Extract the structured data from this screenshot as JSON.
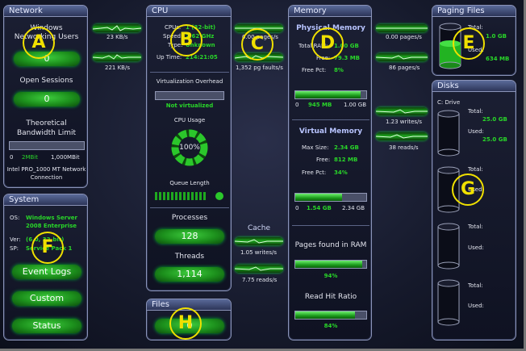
{
  "network": {
    "title": "Network",
    "windows_label": "Windows",
    "networking_users_label": "Networking Users",
    "users_value": "0",
    "open_sessions_label": "Open Sessions",
    "open_sessions_value": "0",
    "bandwidth_label_1": "Theoretical",
    "bandwidth_label_2": "Bandwidth Limit",
    "bw_min": "0",
    "bw_current": "2MBit",
    "bw_max": "1,000MBit",
    "bw_fraction": 0.002,
    "adapter_1": "Intel PRO_1000 MT Network",
    "adapter_2": "Connection",
    "stream_out": "23 KB/s",
    "stream_in": "221 KB/s"
  },
  "system": {
    "title": "System",
    "os_label": "OS:",
    "os_value_1": "Windows Server",
    "os_value_2": "2008 Enterprise",
    "ver_label": "Ver:",
    "ver_value": "(6.0, 32-bit)",
    "sp_label": "SP:",
    "sp_value": "Service Pack 1",
    "event_logs": "Event Logs",
    "custom": "Custom",
    "status": "Status"
  },
  "cpu": {
    "title": "CPU",
    "cpus_label": "CPUs:",
    "cpus_value": "1 (32-bit)",
    "speed_label": "Speed:",
    "speed_value": "2.62 GHz",
    "type_label": "Type:",
    "type_value": "Unknown",
    "uptime_label": "Up Time:",
    "uptime_value": "214:21:05",
    "virt_label": "Virtualization Overhead",
    "virt_status": "Not virtualized",
    "usage_label": "CPU Usage",
    "usage_value": "100%",
    "usage_fraction": 1.0,
    "queue_label": "Queue Length",
    "processes_label": "Processes",
    "processes_value": "128",
    "threads_label": "Threads",
    "threads_value": "1,114",
    "stream_top": "0.00 pages/s",
    "stream_bottom": "1,352 pg faults/s"
  },
  "files": {
    "title": "Files",
    "value": "0"
  },
  "cache": {
    "title": "Cache",
    "writes": "1.05 writes/s",
    "reads": "7.75 reads/s"
  },
  "memory": {
    "title": "Memory",
    "physical_title": "Physical Memory",
    "total_ram_label": "Total RAM:",
    "total_ram_value": "1.00 GB",
    "free_label": "Free:",
    "free_value": "79.3 MB",
    "free_pct_label": "Free Pct:",
    "free_pct_value": "8%",
    "phys_used": "945 MB",
    "phys_min": "0",
    "phys_max": "1.00 GB",
    "phys_fraction": 0.92,
    "virtual_title": "Virtual Memory",
    "max_size_label": "Max Size:",
    "max_size_value": "2.34 GB",
    "vfree_label": "Free:",
    "vfree_value": "812 MB",
    "vfree_pct_label": "Free Pct:",
    "vfree_pct_value": "34%",
    "virt_used": "1.54 GB",
    "virt_min": "0",
    "virt_max": "2.34 GB",
    "virt_fraction": 0.66,
    "pages_ram_label": "Pages found in RAM",
    "pages_ram_value": "94%",
    "pages_ram_fraction": 0.94,
    "read_hit_label": "Read Hit Ratio",
    "read_hit_value": "84%",
    "read_hit_fraction": 0.84
  },
  "paging": {
    "title": "Paging Files",
    "total_label": "Total:",
    "total_value": "1.0 GB",
    "used_label": "Used:",
    "used_value": "634 MB",
    "used_fraction": 0.6,
    "stream_top": "0.00 pages/s",
    "stream_bottom": "86 pages/s"
  },
  "disks": {
    "title": "Disks",
    "drive_label": "C: Drive",
    "total_label": "Total:",
    "total_value": "25.0 GB",
    "used_label": "Used:",
    "used_value": "25.0 GB",
    "stream_top": "1.23 writes/s",
    "stream_bottom": "38 reads/s"
  },
  "markers": [
    "A",
    "B",
    "C",
    "D",
    "E",
    "F",
    "G",
    "H"
  ]
}
